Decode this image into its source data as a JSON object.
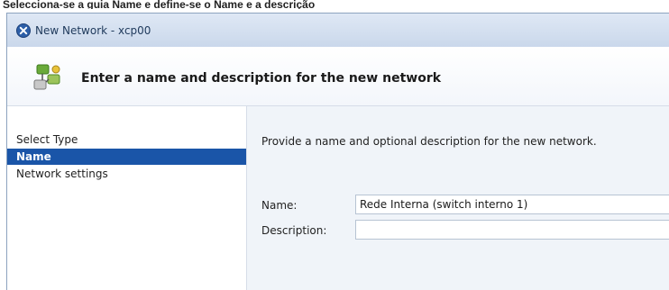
{
  "caption": "Selecciona-se a guia Name e define-se o Name e a descrição",
  "window": {
    "title": "New Network - xcp00",
    "title_icon": "xenserver-circle-icon"
  },
  "header": {
    "icon": "network-icon",
    "heading": "Enter a name and description for the new network"
  },
  "sidebar": {
    "items": [
      {
        "label": "Select Type",
        "selected": false
      },
      {
        "label": "Name",
        "selected": true
      },
      {
        "label": "Network settings",
        "selected": false
      }
    ]
  },
  "form": {
    "intro": "Provide a name and optional description for the new network.",
    "name_label": "Name:",
    "name_value": "Rede Interna (switch interno 1)",
    "description_label": "Description:",
    "description_value": ""
  },
  "colors": {
    "selection": "#1a55a8",
    "titlebar": "#cad8eb",
    "content_bg": "#f0f4f9"
  }
}
